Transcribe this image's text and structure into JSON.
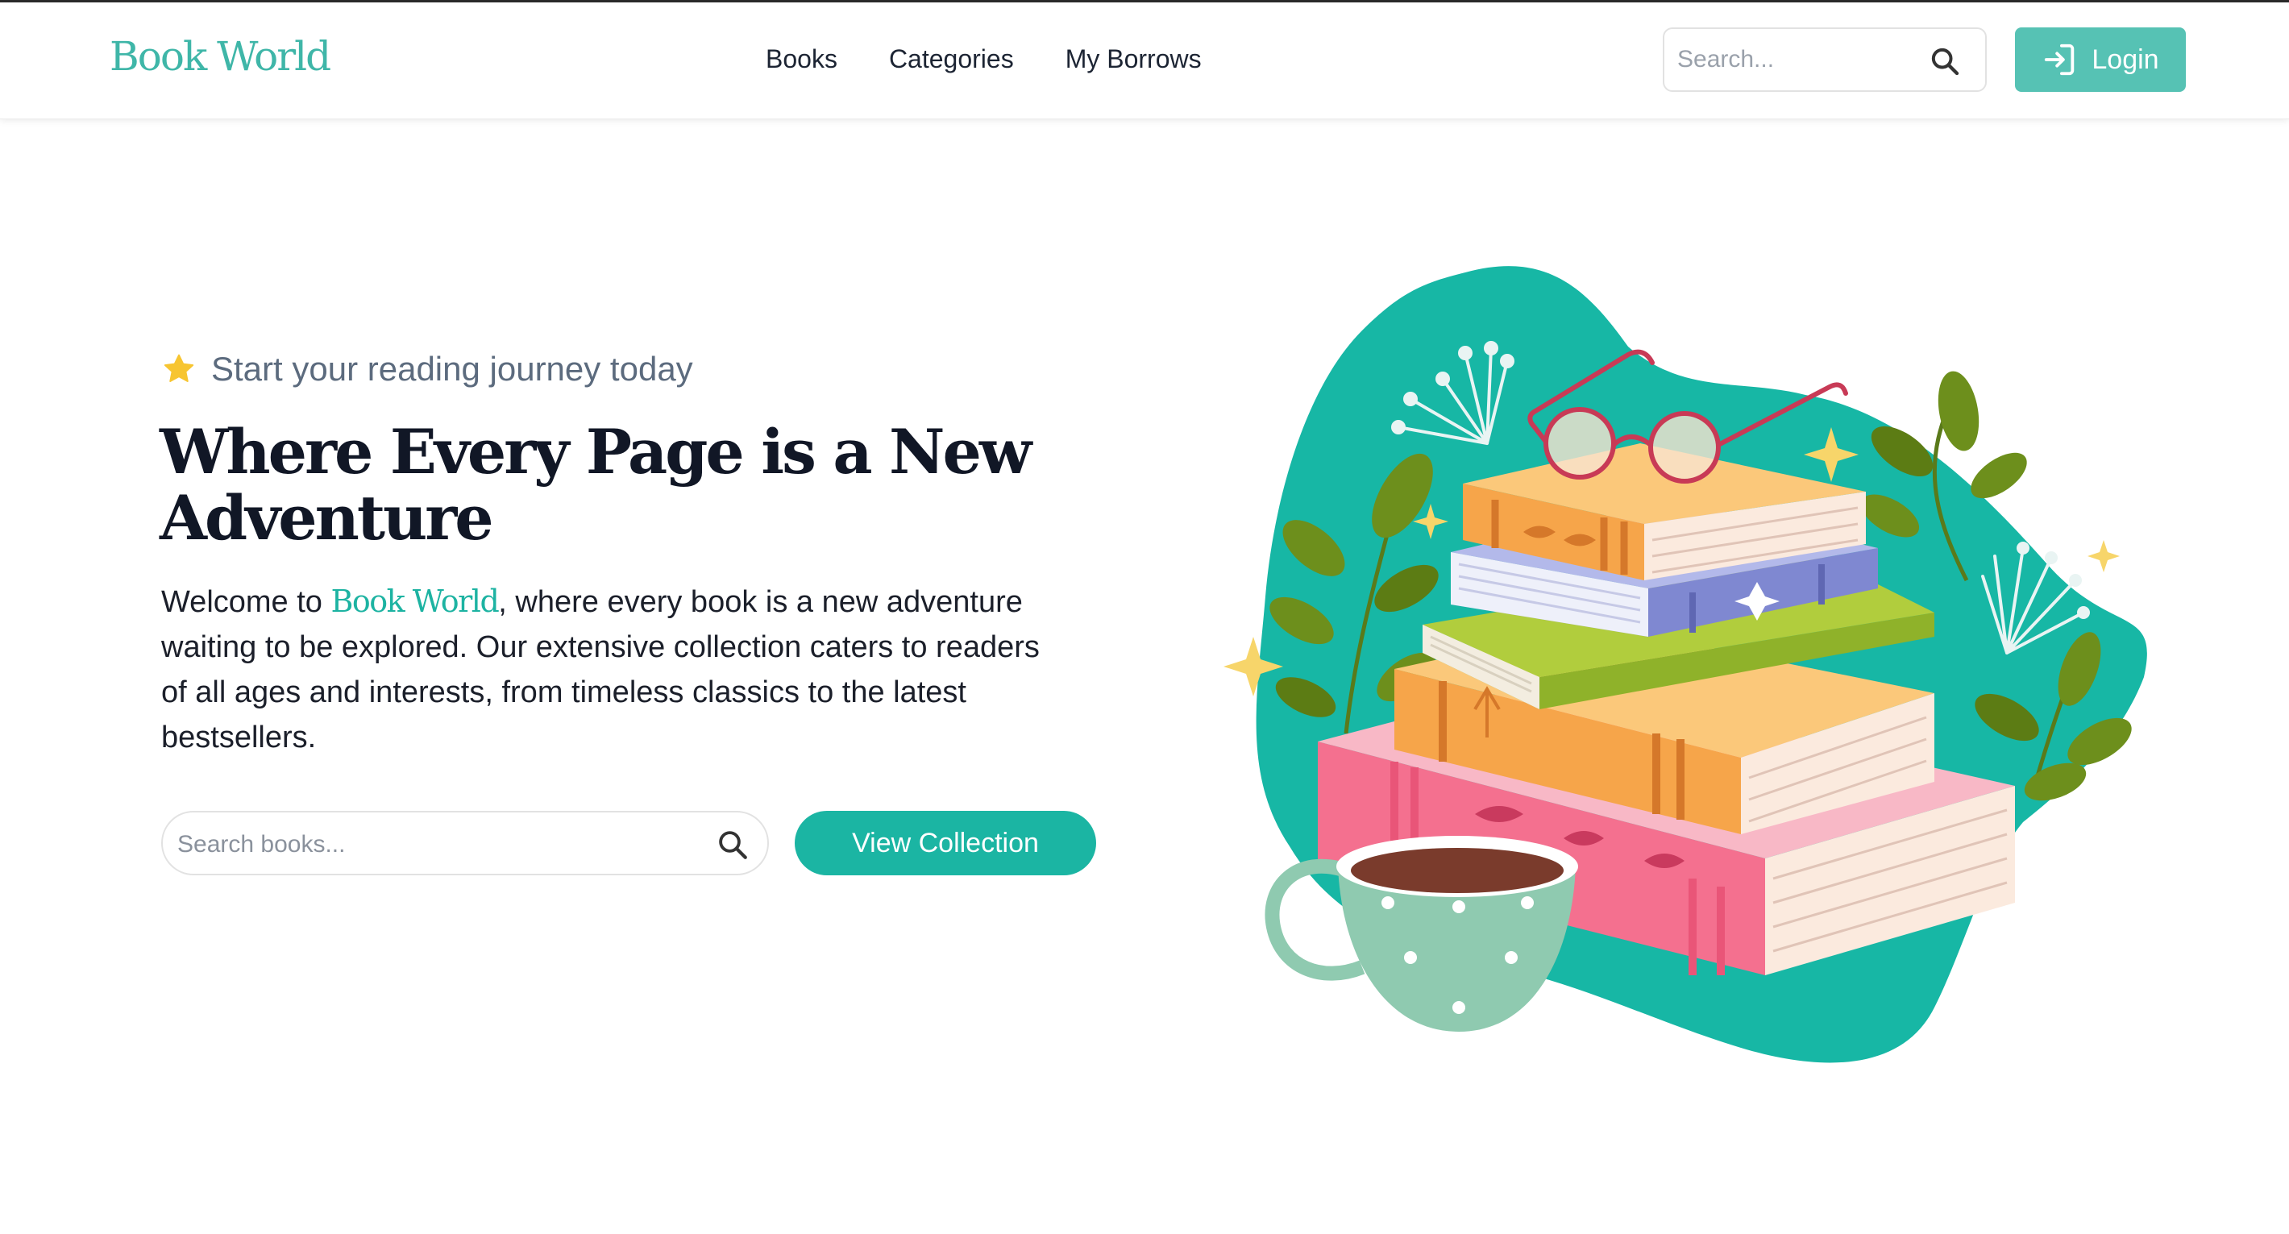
{
  "header": {
    "logo": "Book World",
    "nav": [
      "Books",
      "Categories",
      "My Borrows"
    ],
    "search_placeholder": "Search...",
    "login_label": "Login"
  },
  "hero": {
    "tagline": "Start your reading journey today",
    "headline": "Where Every Page is a New Adventure",
    "intro_prefix": "Welcome to ",
    "intro_brand": "Book World",
    "intro_suffix": ", where every book is a new adventure waiting to be explored. Our extensive collection caters to readers of all ages and interests, from timeless classics to the latest bestsellers.",
    "search_placeholder": "Search books...",
    "cta_label": "View Collection"
  },
  "icons": {
    "header_search": "search-icon",
    "login": "login-icon",
    "tagline": "star-icon",
    "hero_search": "search-icon"
  },
  "colors": {
    "brand": "#3fb6a8",
    "accent": "#1bb5a3",
    "login_button": "#56c2b4",
    "star": "#f7c531",
    "blob": "#17b7a5"
  }
}
